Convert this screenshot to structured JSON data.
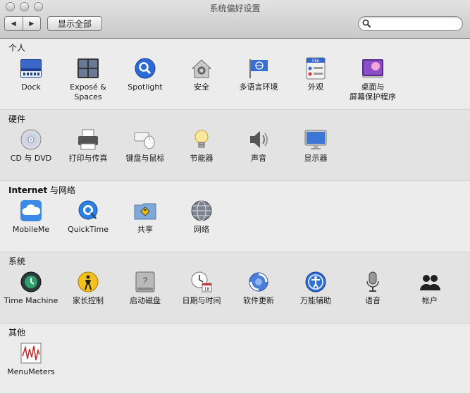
{
  "window": {
    "title": "系统偏好设置"
  },
  "toolbar": {
    "back": "◀",
    "forward": "▶",
    "show_all": "显示全部",
    "search_placeholder": ""
  },
  "sections": [
    {
      "title": "个人",
      "items": [
        {
          "label": "Dock",
          "icon": "dock-icon"
        },
        {
          "label": "Exposé &\nSpaces",
          "icon": "expose-spaces-icon"
        },
        {
          "label": "Spotlight",
          "icon": "spotlight-icon"
        },
        {
          "label": "安全",
          "icon": "security-house-icon"
        },
        {
          "label": "多语言环境",
          "icon": "international-flag-icon"
        },
        {
          "label": "外观",
          "icon": "appearance-icon"
        },
        {
          "label": "桌面与\n屏幕保护程序",
          "icon": "desktop-screensaver-icon"
        }
      ]
    },
    {
      "title": "硬件",
      "items": [
        {
          "label": "CD 与 DVD",
          "icon": "cd-dvd-icon"
        },
        {
          "label": "打印与传真",
          "icon": "printer-icon"
        },
        {
          "label": "键盘与鼠标",
          "icon": "keyboard-mouse-icon"
        },
        {
          "label": "节能器",
          "icon": "lightbulb-icon"
        },
        {
          "label": "声音",
          "icon": "speaker-icon"
        },
        {
          "label": "显示器",
          "icon": "display-icon"
        }
      ]
    },
    {
      "title_bold": "Internet",
      "title": " 与网络",
      "items": [
        {
          "label": "MobileMe",
          "icon": "cloud-icon"
        },
        {
          "label": "QuickTime",
          "icon": "quicktime-icon"
        },
        {
          "label": "共享",
          "icon": "sharing-folder-icon"
        },
        {
          "label": "网络",
          "icon": "network-globe-icon"
        }
      ]
    },
    {
      "title": "系统",
      "items": [
        {
          "label": "Time Machine",
          "icon": "time-machine-icon"
        },
        {
          "label": "家长控制",
          "icon": "parental-controls-icon"
        },
        {
          "label": "启动磁盘",
          "icon": "startup-disk-icon"
        },
        {
          "label": "日期与时间",
          "icon": "date-time-icon"
        },
        {
          "label": "软件更新",
          "icon": "software-update-icon"
        },
        {
          "label": "万能辅助",
          "icon": "accessibility-icon"
        },
        {
          "label": "语音",
          "icon": "microphone-icon"
        },
        {
          "label": "帐户",
          "icon": "accounts-icon"
        }
      ]
    },
    {
      "title": "其他",
      "items": [
        {
          "label": "MenuMeters",
          "icon": "menumeters-icon"
        }
      ]
    }
  ]
}
